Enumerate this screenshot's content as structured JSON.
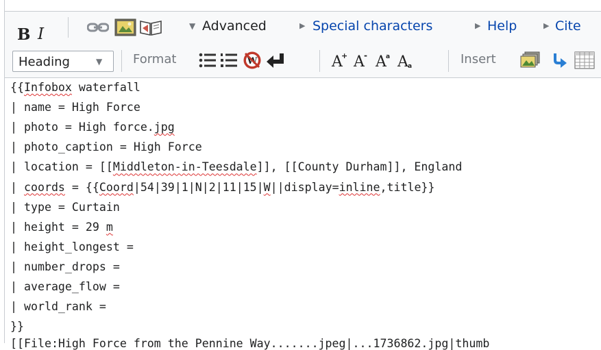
{
  "toolbar": {
    "bold_label": "B",
    "italic_label": "I",
    "link_icon": "link-icon",
    "embedded_file_icon": "embedded-file-icon",
    "reference_icon": "reference-icon",
    "advanced_label": "Advanced",
    "special_characters_label": "Special characters",
    "help_label": "Help",
    "cite_label": "Cite"
  },
  "advanced": {
    "heading_select_value": "Heading",
    "format_label": "Format",
    "insert_label": "Insert"
  },
  "editor": {
    "lines": [
      [
        {
          "t": "{{"
        },
        {
          "t": "Infobox",
          "err": true
        },
        {
          "t": " waterfall"
        }
      ],
      [
        {
          "t": "| name = High Force"
        }
      ],
      [
        {
          "t": "| photo = High force."
        },
        {
          "t": "jpg",
          "err": true
        }
      ],
      [
        {
          "t": "| photo_caption = High Force"
        }
      ],
      [
        {
          "t": "| location = [["
        },
        {
          "t": "Middleton-in-Teesdale",
          "err": true
        },
        {
          "t": "]], [[County Durham]], England"
        }
      ],
      [
        {
          "t": "| "
        },
        {
          "t": "coords",
          "err": true
        },
        {
          "t": " = {{"
        },
        {
          "t": "Coord",
          "err": true
        },
        {
          "t": "|54|39|1|N|2|11|15|"
        },
        {
          "t": "W",
          "err": true
        },
        {
          "t": "||display="
        },
        {
          "t": "inline",
          "err": true
        },
        {
          "t": ",title}}"
        }
      ],
      [
        {
          "t": "| type = Curtain"
        }
      ],
      [
        {
          "t": "| height = 29 "
        },
        {
          "t": "m",
          "err": true
        }
      ],
      [
        {
          "t": "| height_longest ="
        }
      ],
      [
        {
          "t": "| number_drops ="
        }
      ],
      [
        {
          "t": "| average_flow ="
        }
      ],
      [
        {
          "t": "| world_rank ="
        }
      ],
      [
        {
          "t": "}}"
        }
      ]
    ],
    "cut_line": "[[File:High Force from the Pennine Way.......jpeg|...1736862.jpg|thumb"
  }
}
